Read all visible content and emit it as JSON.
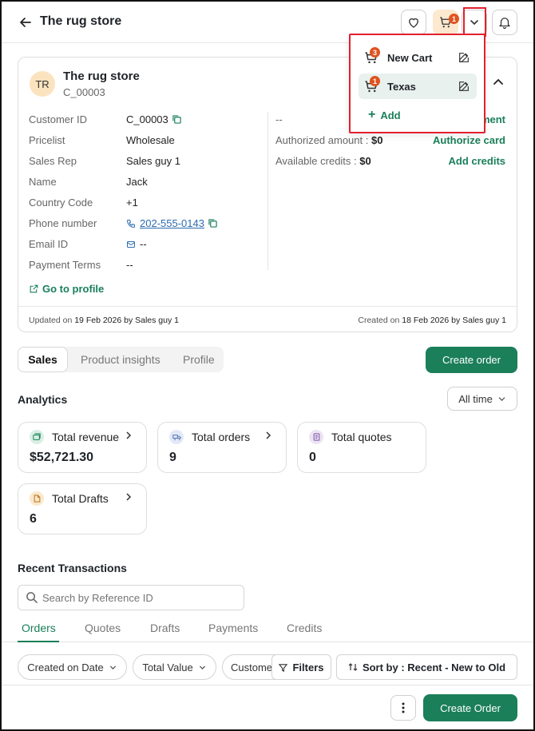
{
  "header": {
    "title": "The rug store",
    "cart_badge": "1"
  },
  "cart_menu": {
    "items": [
      {
        "label": "New Cart",
        "badge": "3",
        "active": false
      },
      {
        "label": "Texas",
        "badge": "1",
        "active": true
      }
    ],
    "add_label": "Add"
  },
  "customer": {
    "initials": "TR",
    "name": "The rug store",
    "code": "C_00003",
    "details": [
      {
        "label": "Customer ID",
        "value": "C_00003"
      },
      {
        "label": "Pricelist",
        "value": "Wholesale"
      },
      {
        "label": "Sales Rep",
        "value": "Sales guy 1"
      },
      {
        "label": "Name",
        "value": "Jack"
      },
      {
        "label": "Country Code",
        "value": "+1"
      },
      {
        "label": "Phone number",
        "value": "202-555-0143"
      },
      {
        "label": "Email ID",
        "value": "--"
      },
      {
        "label": "Payment Terms",
        "value": "--"
      }
    ],
    "right": {
      "top_value": "--",
      "top_link": "ment",
      "authorized_label": "Authorized amount :",
      "authorized_value": "$0",
      "authorize_link": "Authorize card",
      "credits_label": "Available credits :",
      "credits_value": "$0",
      "credits_link": "Add credits"
    },
    "go_to_profile": "Go to profile",
    "updated_prefix": "Updated on",
    "updated": "19 Feb 2026 by Sales guy 1",
    "created_prefix": "Created on",
    "created": "18 Feb 2026 by Sales guy 1"
  },
  "tabs": {
    "items": [
      "Sales",
      "Product insights",
      "Profile"
    ],
    "active": "Sales"
  },
  "create_order_top": "Create order",
  "analytics": {
    "title": "Analytics",
    "range": "All time",
    "stats": [
      {
        "label": "Total revenue",
        "value": "$52,721.30",
        "color": "#d9efe4"
      },
      {
        "label": "Total orders",
        "value": "9",
        "color": "#e2e8f6"
      },
      {
        "label": "Total quotes",
        "value": "0",
        "color": "#ece3f3"
      },
      {
        "label": "Total Drafts",
        "value": "6",
        "color": "#fbe8cc"
      }
    ]
  },
  "recent": {
    "title": "Recent Transactions",
    "search_placeholder": "Search by Reference ID",
    "tabs": [
      "Orders",
      "Quotes",
      "Drafts",
      "Payments",
      "Credits"
    ],
    "active_tab": "Orders",
    "filters": {
      "created_on": "Created on Date",
      "total_value": "Total Value",
      "customer": "Custome",
      "filters_btn": "Filters",
      "sort_btn": "Sort by : Recent - New to Old"
    }
  },
  "create_order_bottom": "Create Order",
  "colors": {
    "primary": "#1b7f5a",
    "badge": "#e0531f",
    "highlight": "#e3202e"
  }
}
